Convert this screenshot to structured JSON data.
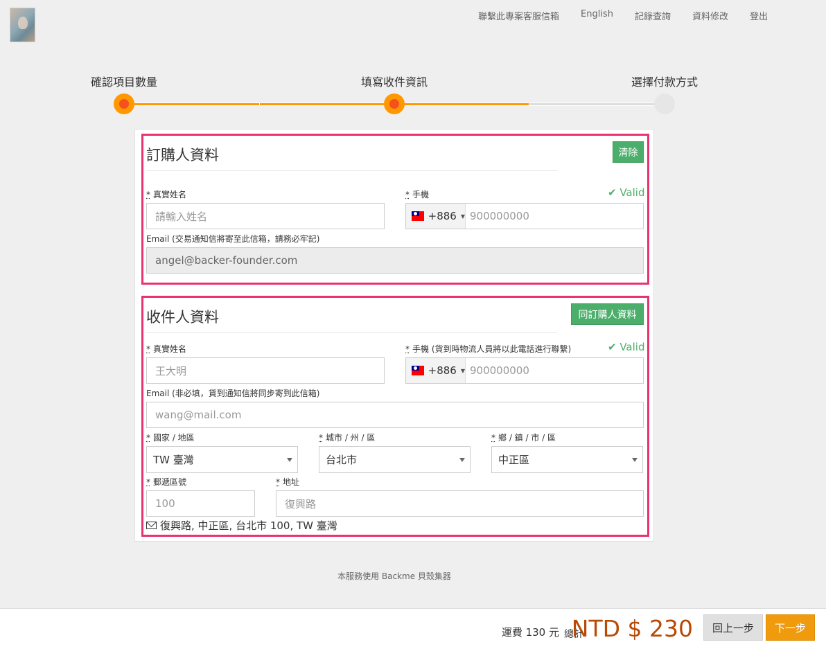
{
  "nav": {
    "links": [
      "聯繫此專案客服信箱",
      "English",
      "記錄查詢",
      "資料修改",
      "登出"
    ]
  },
  "steps": [
    {
      "label": "確認項目數量",
      "state": "done"
    },
    {
      "label": "填寫收件資訊",
      "state": "current"
    },
    {
      "label": "選擇付款方式",
      "state": "pending"
    }
  ],
  "buyer": {
    "title": "訂購人資料",
    "clear_button": "清除",
    "name_label": "真實姓名",
    "name_placeholder": "請輸入姓名",
    "phone_label": "手機",
    "phone_valid": "✔ Valid",
    "phone_country_code": "+886",
    "phone_placeholder": "900000000",
    "email_label": "Email (交易通知信將寄至此信箱，請務必牢記)",
    "email_value": "angel@backer-founder.com"
  },
  "recipient": {
    "title": "收件人資料",
    "copy_button": "同訂購人資料",
    "name_label": "真實姓名",
    "name_placeholder": "王大明",
    "phone_label": "手機 (貨到時物流人員將以此電話進行聯繫)",
    "phone_valid": "✔ Valid",
    "phone_country_code": "+886",
    "phone_placeholder": "900000000",
    "email_label": "Email (非必填，貨到通知信將同步寄到此信箱)",
    "email_placeholder": "wang@mail.com",
    "country_label": "國家 / 地區",
    "country_value": "TW 臺灣",
    "city_label": "城市 / 州 / 區",
    "city_value": "台北市",
    "district_label": "鄉 / 鎮 / 市 / 區",
    "district_value": "中正區",
    "zip_label": "郵遞區號",
    "zip_placeholder": "100",
    "address_label": "地址",
    "address_placeholder": "復興路",
    "address_summary": "復興路, 中正區, 台北市 100, TW 臺灣"
  },
  "footer_note": "本服務使用 Backme 貝殼集器",
  "checkout": {
    "shipping": "運費 130 元",
    "total_label": "總計",
    "total_amount": "NTD $ 230",
    "back_button": "回上一步",
    "next_button": "下一步"
  },
  "colors": {
    "step_active": "#ff9800",
    "highlight_border": "#e8336e",
    "green_button": "#4cae6b",
    "next_button": "#f09a0e",
    "total_amount": "#b84a05"
  }
}
